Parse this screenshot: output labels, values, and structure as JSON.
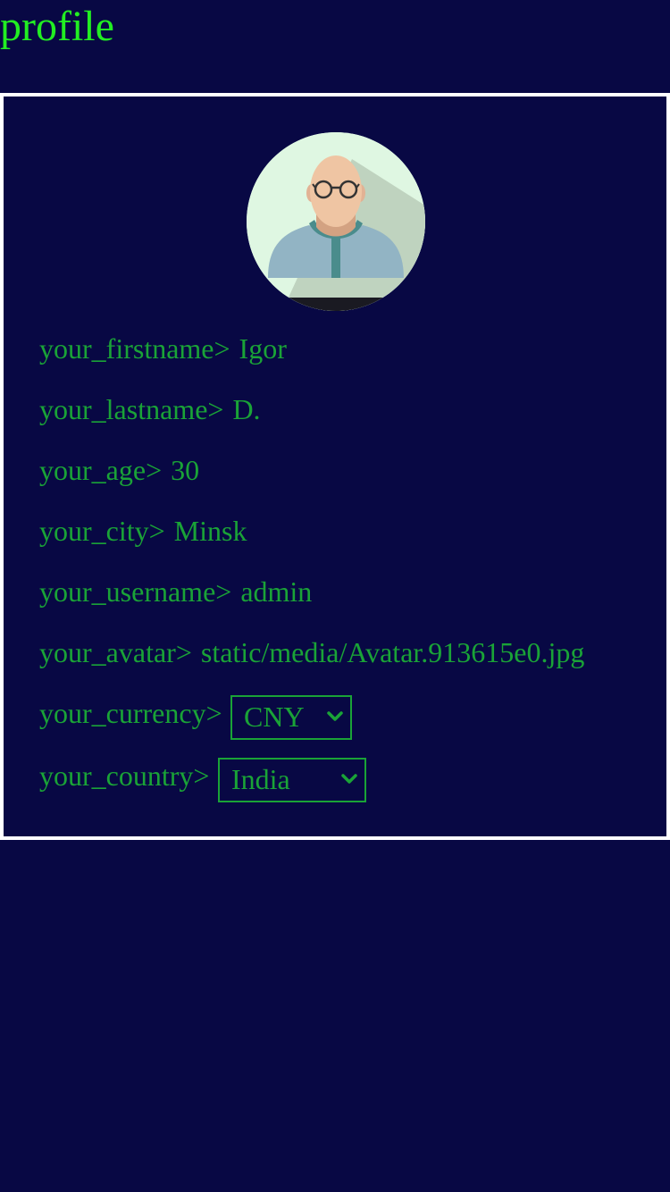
{
  "page": {
    "title": "profile"
  },
  "profile": {
    "avatar_icon": "person-avatar-icon",
    "fields": {
      "firstname": {
        "label": "your_firstname>",
        "value": "Igor"
      },
      "lastname": {
        "label": "your_lastname>",
        "value": "D."
      },
      "age": {
        "label": "your_age>",
        "value": "30"
      },
      "city": {
        "label": "your_city>",
        "value": "Minsk"
      },
      "username": {
        "label": "your_username>",
        "value": "admin"
      },
      "avatar": {
        "label": "your_avatar>",
        "value": "static/media/Avatar.913615e0.jpg"
      }
    },
    "currency": {
      "label": "your_currency>",
      "selected": "CNY"
    },
    "country": {
      "label": "your_country>",
      "selected": "India"
    }
  },
  "colors": {
    "background": "#080844",
    "title": "#22ee22",
    "text": "#1aa337",
    "card_border": "#ffffff"
  }
}
